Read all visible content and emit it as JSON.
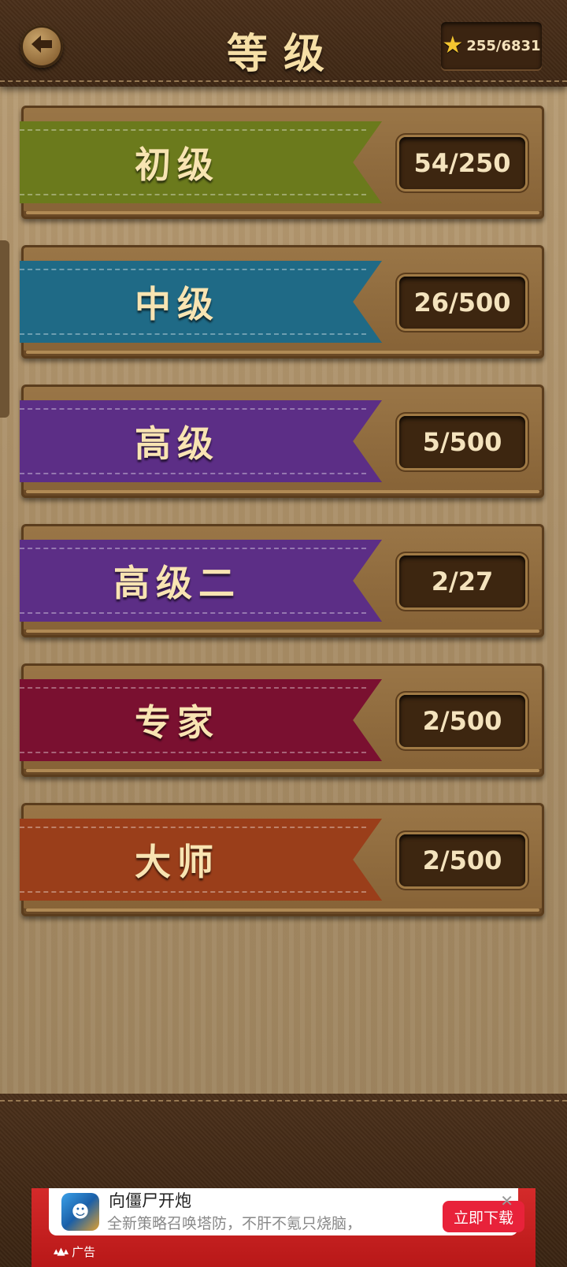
{
  "header": {
    "title": "等级",
    "back_icon": "back-arrow-icon",
    "stars": "255/6831",
    "star_icon": "star-icon"
  },
  "levels": [
    {
      "label": "初级",
      "progress": "54/250",
      "color": "#6b7a1c"
    },
    {
      "label": "中级",
      "progress": "26/500",
      "color": "#1f6a86"
    },
    {
      "label": "高级",
      "progress": "5/500",
      "color": "#5c2e86"
    },
    {
      "label": "高级二",
      "progress": "2/27",
      "color": "#5c2e86"
    },
    {
      "label": "专家",
      "progress": "2/500",
      "color": "#7a1030"
    },
    {
      "label": "大师",
      "progress": "2/500",
      "color": "#9a3e1a"
    }
  ],
  "ad": {
    "title": "向僵尸开炮",
    "description": "全新策略召唤塔防，不肝不氪只烧脑，快来...",
    "button": "立即下载",
    "tag": "广告",
    "close_icon": "close-icon"
  }
}
